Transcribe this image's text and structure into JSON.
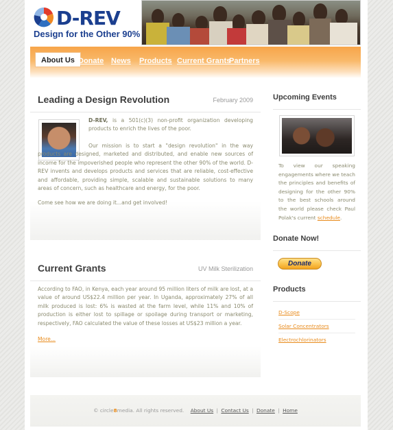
{
  "colors": {
    "brand_blue": "#1b3f8f",
    "accent_orange": "#f7a54a",
    "link_orange": "#e88a1a",
    "body_text": "#8a8a6e"
  },
  "logo": {
    "word": "D-REV",
    "tagline": "Design for the Other 90%"
  },
  "nav": {
    "items": [
      {
        "label": "About Us",
        "active": true
      },
      {
        "label": "Donate"
      },
      {
        "label": "News"
      },
      {
        "label": "Products"
      },
      {
        "label": "Current Grants"
      },
      {
        "label": "Partners"
      }
    ]
  },
  "main": {
    "leading": {
      "title": "Leading a Design Revolution",
      "date": "February 2009",
      "intro_bold": "D-REV,",
      "intro_rest": "is a 501(c)(3) non-profit organization developing products to enrich the lives of the poor.",
      "mission": "Our mission is to start a \"design revolution\" in the way products are designed, marketed and distributed, and enable new sources of income for the impoverished people who represent the other 90% of the world. D-REV invents and develops products and services that are reliable, cost-effective and affordable, providing simple, scalable and sustainable solutions to many areas of concern, such as healthcare and energy, for the poor.",
      "cta": "Come see how we are doing it...and get involved!"
    },
    "grants": {
      "title": "Current Grants",
      "subtitle": "UV Milk Sterilization",
      "body": "According to FAO, in Kenya, each year around 95 million liters of milk are lost, at a value of around US$22.4 million per year. In Uganda, approximately 27% of all milk produced is lost: 6% is wasted at the farm level, while 11% and 10% of production is either lost to spillage or spoilage during transport or marketing, respectively, FAO calculated the value of these losses at US$23 million a year.",
      "more": "More..."
    }
  },
  "sidebar": {
    "events": {
      "title": "Upcoming Events",
      "text": "To view our speaking engagements where we teach the principles and benefits of designing for the other 90% to the best schools around the world please check Paul Polak's current",
      "link": "schedule",
      "period": "."
    },
    "donate": {
      "title": "Donate Now!",
      "button": "Donate"
    },
    "products": {
      "title": "Products",
      "items": [
        "D-Scope",
        "Solar Concentrators",
        "Electrochlorinators"
      ]
    }
  },
  "footer": {
    "copy_prefix": "© circle",
    "copy_8": "8",
    "copy_suffix": "media. All rights reserved.",
    "links": [
      "About Us",
      "Contact Us",
      "Donate",
      "Home"
    ],
    "separator": "|"
  }
}
